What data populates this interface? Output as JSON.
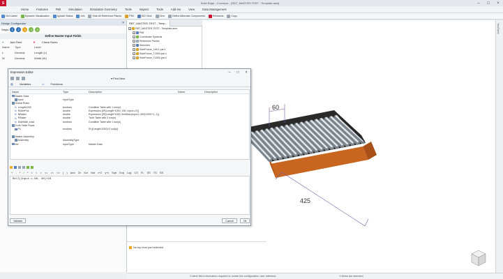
{
  "titlebar": {
    "logo": "S",
    "title": "Solid Edge - Conveyor - [RBT_MASTER-TEST - Template.asm]"
  },
  "menu": [
    "Home",
    "Features",
    "PMI",
    "Simulation",
    "Simulation Geometry",
    "Tools",
    "Inspect",
    "Tools",
    "Add-ins",
    "View",
    "Data Management"
  ],
  "toolbar": [
    {
      "label": "Get Latest",
      "color": "#4f8ad1"
    },
    {
      "label": "Dynamic Visualization",
      "color": "#7ab648"
    },
    {
      "label": "Update Status",
      "color": "#4f8ad1"
    },
    {
      "label": "Info",
      "color": "#4f8ad1"
    },
    {
      "label": "Hide All Reference Planes",
      "color": "#9aa6b2"
    },
    {
      "label": "PMI",
      "color": "#d9a12a"
    },
    {
      "label": "ISO View",
      "color": "#5a7fb8"
    },
    {
      "label": "Zero",
      "color": "#9aa6b2"
    },
    {
      "label": "Define Alternate Components",
      "color": "#9aa6b2"
    },
    {
      "label": "Revisions",
      "color": "#c8102e"
    },
    {
      "label": "Copy",
      "color": "#9aa6b2"
    }
  ],
  "left_panel": {
    "title": "Design Configurator",
    "steps_label": "Steps",
    "steps": [
      {
        "num": "1",
        "color": "#2f6fb8"
      },
      {
        "num": "2",
        "color": "#2f6fb8"
      },
      {
        "num": "3",
        "color": "#e8a21a"
      },
      {
        "num": "4",
        "color": "#7ab648"
      },
      {
        "num": "5",
        "color": "#7ab648"
      }
    ],
    "subheader": "Define Master Input Fields",
    "actions": [
      "Add Field",
      "Check Rules"
    ],
    "columns": [
      "Name",
      "Type",
      "Label"
    ],
    "rows": [
      {
        "name": "L",
        "type": "Decimal",
        "label": "Length (L)"
      },
      {
        "name": "W",
        "type": "Decimal",
        "label": "Width (W)"
      }
    ]
  },
  "tree": {
    "tab": "RBT_MASTER-TEST - Temp...",
    "rows": [
      {
        "label": "RBT_MASTER-TEST - Template.asm",
        "indent": 0
      },
      {
        "label": "PMI",
        "indent": 2
      },
      {
        "label": "Coordinate Systems",
        "indent": 2
      },
      {
        "label": "Reference Planes",
        "indent": 2
      },
      {
        "label": "Sketches",
        "indent": 2
      },
      {
        "label": "SideFrame_Left:1.par:1",
        "indent": 2
      },
      {
        "label": "SideFrame_TL500.par:1",
        "indent": 2
      },
      {
        "label": "SideFrame_TL500.par:2",
        "indent": 2
      }
    ]
  },
  "dialog": {
    "title": "Expression Editor",
    "find": "Find Next",
    "tabs": [
      "Variables",
      "Functions"
    ],
    "headers": [
      "Name",
      "Type",
      "Description",
      "Name",
      "Description"
    ],
    "rows": [
      {
        "name": "Master Data",
        "type": "",
        "desc": "",
        "indent": 0,
        "ico": "box"
      },
      {
        "name": "Input",
        "type": "InputType",
        "desc": "",
        "indent": 1,
        "ico": "box"
      },
      {
        "name": "Global Rules",
        "type": "",
        "desc": "",
        "indent": 0,
        "ico": "box"
      },
      {
        "name": "Length1000",
        "type": "boolean",
        "desc": "Condition Table with 1 row(s)",
        "indent": 1,
        "ico": "fx"
      },
      {
        "name": "RollerPos",
        "type": "double",
        "desc": "Expression [IIF(Length*1000, 150, Input.L/2)]",
        "indent": 1,
        "ico": "fx"
      },
      {
        "name": "NBaker",
        "type": "double",
        "desc": "Expression [IIF(Length*1000, limitMax(Input.L-300)/1000+1, 1)]",
        "indent": 1,
        "ico": "fx"
      },
      {
        "name": "PBaker",
        "type": "double",
        "desc": "Truth Table with 2 row(s)",
        "indent": 1,
        "ico": "fx"
      },
      {
        "name": "SideWall_exist",
        "type": "boolean",
        "desc": "Condition Table with 1 row(s)",
        "indent": 1,
        "ico": "fx"
      },
      {
        "name": "Truth Table Rows",
        "type": "",
        "desc": "",
        "indent": 0,
        "ico": "box"
      },
      {
        "name": "P1",
        "type": "boolean",
        "desc": "IIf ((Length/1000)*2 cut(s))",
        "indent": 1,
        "ico": "box"
      },
      {
        "name": "",
        "type": "",
        "desc": "",
        "indent": 1,
        "ico": ""
      },
      {
        "name": "Master Assembly",
        "type": "",
        "desc": "",
        "indent": 0,
        "ico": "box"
      },
      {
        "name": "Assembly",
        "type": "AssemblyType",
        "desc": "",
        "indent": 1,
        "ico": "box"
      },
      {
        "name": "Me",
        "type": "InputType",
        "desc": "Master Data",
        "indent": 0,
        "ico": "box"
      }
    ],
    "operators": [
      "+",
      "-",
      "*",
      "/",
      "^",
      "=",
      "<",
      ">",
      "<=",
      ">=",
      "<>",
      "(",
      ")",
      "And",
      "Or",
      "Xor",
      "Not",
      "x^2",
      "y^x",
      "Sqrt",
      "Exp",
      "Log",
      "CS",
      "FL",
      "SS",
      "TS",
      "SS"
    ],
    "expression": "Roll(Input.L-60, 40)+10",
    "validate": "Validate",
    "cancel": "Cancel",
    "ok": "Ok"
  },
  "model": {
    "dim_top": "60",
    "dim_bottom": "425"
  },
  "messages": {
    "text": "No top level part selected."
  },
  "statusbar": {
    "left": "Collect field information required to create the configuration user interface.",
    "mid": "0 items are selected"
  },
  "right_strip": "YouTube"
}
